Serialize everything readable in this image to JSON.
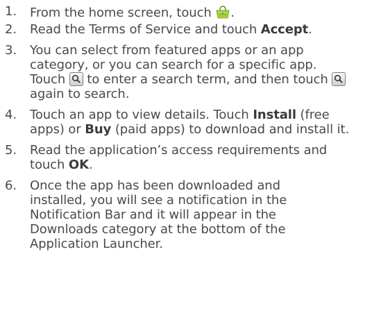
{
  "steps": [
    {
      "number": "1.",
      "text_before": "From the home screen, touch",
      "icon": "android-market-icon",
      "text_after": "."
    },
    {
      "number": "2.",
      "text_before": "Read the Terms of Service and touch ",
      "bold": "Accept",
      "text_after": "."
    },
    {
      "number": "3.",
      "text_a": "You can select from featured apps or an app category, or you can search for a specific app. Touch",
      "icon": "search-icon",
      "text_b": "to enter a search term, and then touch",
      "text_c": "again to search."
    },
    {
      "number": "4.",
      "text_a": "Touch an app to view details. Touch ",
      "bold_a": "Install",
      "text_b": " (free apps) or ",
      "bold_b": "Buy",
      "text_c": " (paid apps) to download and install it."
    },
    {
      "number": "5.",
      "text_before": "Read the application’s access requirements and touch ",
      "bold": "OK",
      "text_after": "."
    },
    {
      "number": "6.",
      "text": "Once the app has been downloaded and installed, you will see a notification in the Notification Bar and it will appear in the Downloads category at the bottom of the Application Launcher."
    }
  ],
  "colors": {
    "text": "#4a4a4a",
    "icon_green": "#8fbf2f",
    "search_border": "#7c7c7c"
  }
}
